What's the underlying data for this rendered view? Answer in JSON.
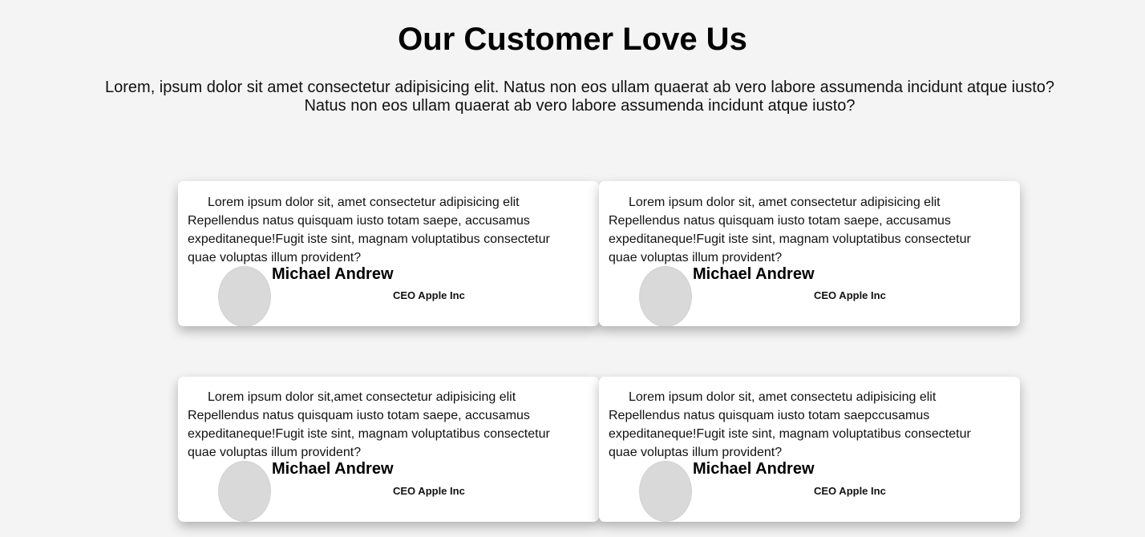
{
  "header": {
    "title": "Our Customer Love Us",
    "subtitle": "Lorem, ipsum dolor sit amet consectetur adipisicing elit. Natus non eos ullam quaerat ab vero labore assumenda incidunt atque iusto? Natus non eos ullam quaerat ab vero labore assumenda incidunt atque iusto?"
  },
  "testimonials": [
    {
      "text": "Lorem ipsum dolor sit, amet consectetur adipisicing elit Repellendus natus quisquam iusto totam saepe, accusamus expeditaneque!Fugit iste sint, magnam voluptatibus consectetur quae voluptas illum provident?",
      "name": "Michael Andrew",
      "role": "CEO Apple Inc"
    },
    {
      "text": "Lorem ipsum dolor sit, amet consectetur adipisicing elit Repellendus natus quisquam iusto totam saepe, accusamus expeditaneque!Fugit iste sint, magnam voluptatibus consectetur quae voluptas illum provident?",
      "name": "Michael Andrew",
      "role": "CEO Apple Inc"
    },
    {
      "text": "Lorem ipsum dolor sit,amet consectetur adipisicing elit Repellendus natus quisquam iusto totam saepe, accusamus expeditaneque!Fugit iste sint, magnam voluptatibus consectetur quae voluptas illum provident?",
      "name": "Michael Andrew",
      "role": "CEO Apple Inc"
    },
    {
      "text": "Lorem ipsum dolor sit, amet consectetu adipisicing elit Repellendus natus quisquam iusto totam saepccusamus expeditaneque!Fugit iste sint, magnam voluptatibus consectetur quae voluptas illum provident?",
      "name": "Michael Andrew",
      "role": "CEO Apple Inc"
    }
  ],
  "colors": {
    "background": "#f4f4f4",
    "card": "#ffffff",
    "avatar_placeholder": "#d9d9d9"
  }
}
